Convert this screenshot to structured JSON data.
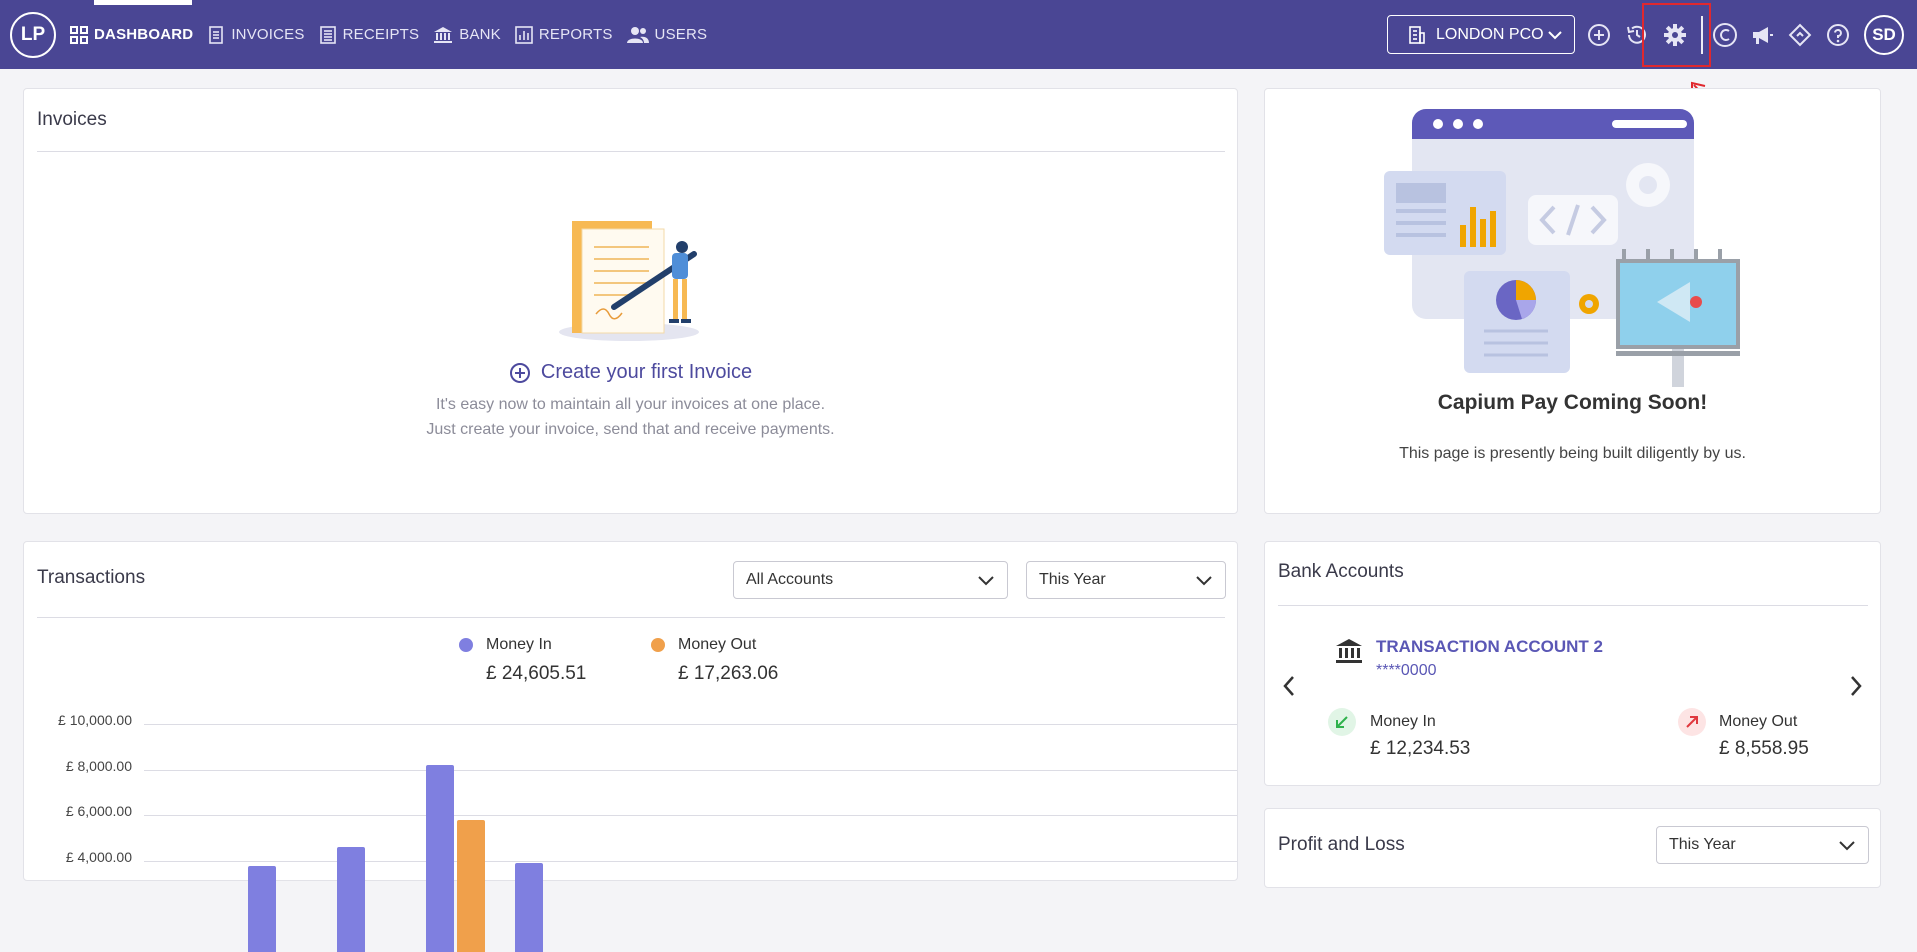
{
  "header": {
    "logo_text": "LP",
    "nav": [
      {
        "label": "DASHBOARD",
        "icon": "grid-icon",
        "active": true
      },
      {
        "label": "INVOICES",
        "icon": "invoice-icon",
        "active": false
      },
      {
        "label": "RECEIPTS",
        "icon": "receipt-icon",
        "active": false
      },
      {
        "label": "BANK",
        "icon": "bank-icon",
        "active": false
      },
      {
        "label": "REPORTS",
        "icon": "chart-icon",
        "active": false
      },
      {
        "label": "USERS",
        "icon": "users-icon",
        "active": false
      }
    ],
    "company_select": "LONDON PCO",
    "avatar": "SD",
    "colors": {
      "bar": "#4a4694",
      "highlight": "#e0282e"
    }
  },
  "invoices": {
    "title": "Invoices",
    "cta": "Create your first Invoice",
    "line1": "It's easy now to maintain all your invoices at one place.",
    "line2": "Just create your invoice, send that and receive payments."
  },
  "capium_pay": {
    "title": "Capium Pay Coming Soon!",
    "subtitle": "This page is presently being built diligently by us."
  },
  "transactions": {
    "title": "Transactions",
    "account_filter": "All Accounts",
    "period_filter": "This Year",
    "money_in_label": "Money In",
    "money_in_value": "£ 24,605.51",
    "money_out_label": "Money Out",
    "money_out_value": "£ 17,263.06",
    "colors": {
      "in": "#7f7fe0",
      "out": "#f0a04b"
    }
  },
  "chart_data": {
    "type": "bar",
    "y_ticks": [
      "£ 10,000.00",
      "£ 8,000.00",
      "£ 6,000.00",
      "£ 4,000.00"
    ],
    "ylim": [
      0,
      10000
    ],
    "series": [
      {
        "name": "Money In",
        "values": [
          3800,
          4600,
          8200,
          3900
        ]
      },
      {
        "name": "Money Out",
        "values": [
          0,
          0,
          5800,
          0
        ]
      }
    ]
  },
  "bank_accounts": {
    "title": "Bank Accounts",
    "account_name": "TRANSACTION ACCOUNT 2",
    "account_number": "****0000",
    "money_in_label": "Money In",
    "money_in_value": "£ 12,234.53",
    "money_out_label": "Money Out",
    "money_out_value": "£ 8,558.95"
  },
  "profit_loss": {
    "title": "Profit and Loss",
    "period_filter": "This Year"
  }
}
